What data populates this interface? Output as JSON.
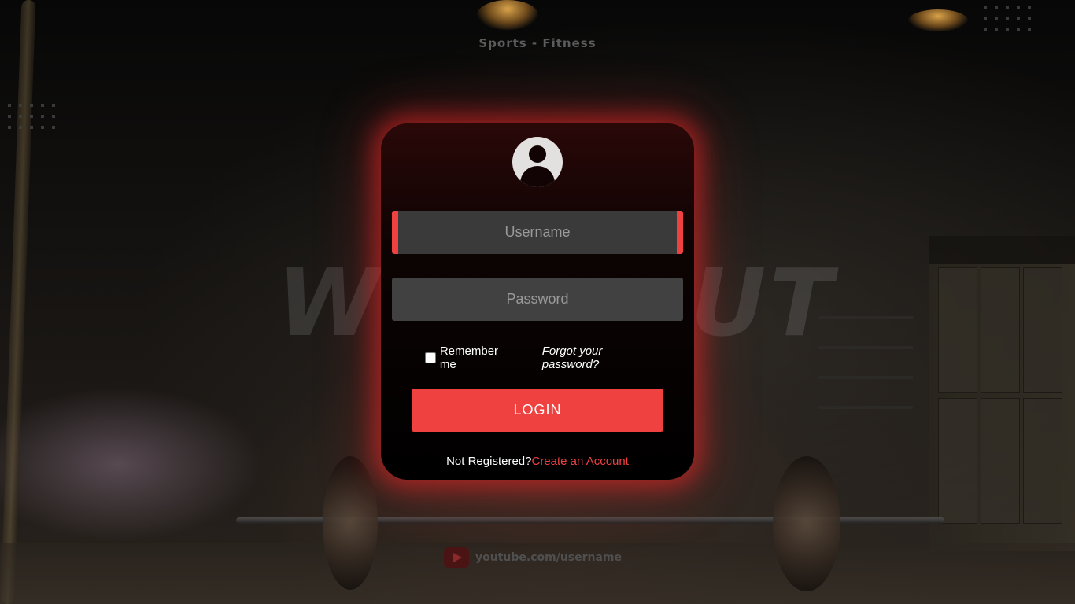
{
  "brand": "Sports - Fitness",
  "watermark": "WORKOUT",
  "login": {
    "username_placeholder": "Username",
    "password_placeholder": "Password",
    "remember_label": "Remember me",
    "forgot_label": "Forgot your password?",
    "login_label": "LOGIN",
    "not_registered": "Not Registered?",
    "create_account": "Create an Account"
  },
  "footer": {
    "youtube_text": "youtube.com/username",
    "icon": "youtube-icon"
  },
  "colors": {
    "accent": "#f04141",
    "card_glow": "#e62828",
    "field_bg": "#3a3a3a"
  }
}
